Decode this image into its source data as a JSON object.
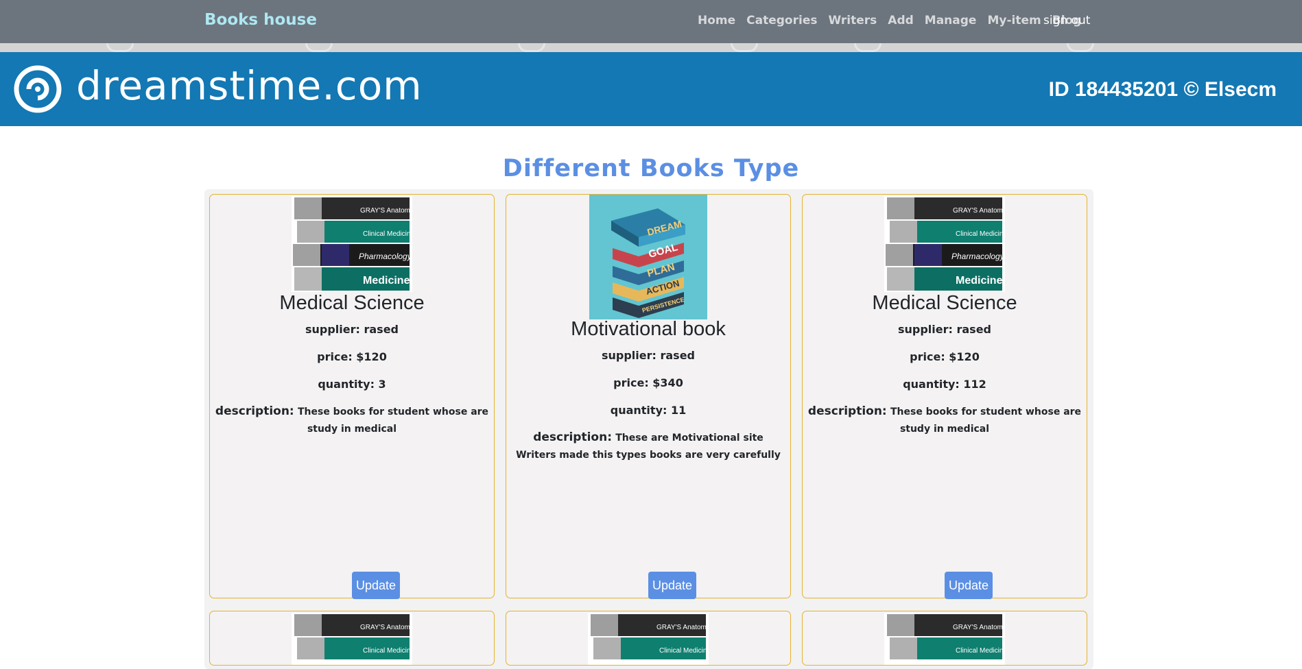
{
  "nav": {
    "brand": "Books house",
    "links": [
      "Home",
      "Categories",
      "Writers",
      "Add",
      "Manage",
      "My-item",
      "Blog"
    ],
    "sign_out": "sign out"
  },
  "banner": {
    "site": "dreamstime.com",
    "id_text": "ID 184435201 © Elsecm"
  },
  "section": {
    "title": "Different Books Type"
  },
  "cards": [
    {
      "image": "medical-books-image",
      "title": "Medical Science",
      "supplier": "supplier: rased",
      "price": "price: $120",
      "quantity": "quantity: 3",
      "desc_label": "description:",
      "desc_text": "These books for student whose are study in medical",
      "button": "Update"
    },
    {
      "image": "motivational-books-image",
      "image_words": [
        "DREAM",
        "GOAL",
        "PLAN",
        "ACTION",
        "PERSISTENCE"
      ],
      "title": "Motivational book",
      "supplier": "supplier: rased",
      "price": "price: $340",
      "quantity": "quantity: 11",
      "desc_label": "description:",
      "desc_text": "These are Motivational site Writers made this types books are very carefully",
      "button": "Update"
    },
    {
      "image": "medical-books-image",
      "title": "Medical Science",
      "supplier": "supplier: rased",
      "price": "price: $120",
      "quantity": "quantity: 112",
      "desc_label": "description:",
      "desc_text": "These books for student whose are study in medical",
      "button": "Update"
    }
  ],
  "book_cover_labels": {
    "a": "GRAY'S Anatomy",
    "b": "Clinical Medicine",
    "c": "Pharmacology",
    "d": "Medicine"
  },
  "colors": {
    "navbar": "#6c757d",
    "brand": "#aee7f2",
    "banner": "#1378b3",
    "accent": "#5b8fe3",
    "card_border": "#e5b22f",
    "card_bg": "#f4f2f3"
  }
}
